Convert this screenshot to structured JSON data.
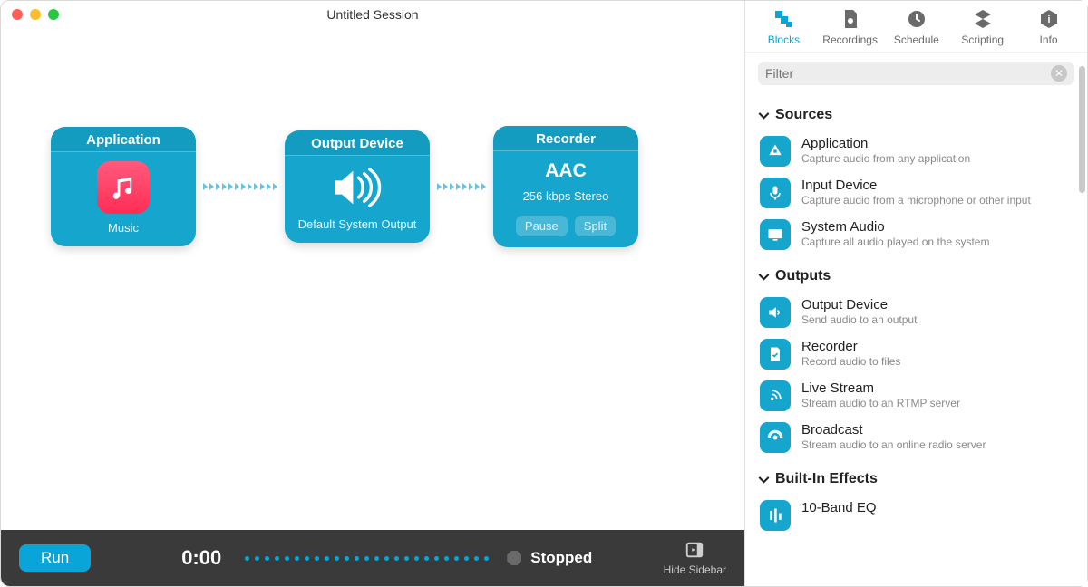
{
  "window": {
    "title": "Untitled Session"
  },
  "flow": {
    "blocks": [
      {
        "header": "Application",
        "label": "Music"
      },
      {
        "header": "Output Device",
        "label": "Default System Output"
      },
      {
        "header": "Recorder",
        "codec": "AAC",
        "detail": "256 kbps Stereo",
        "btn_pause": "Pause",
        "btn_split": "Split"
      }
    ]
  },
  "footer": {
    "run": "Run",
    "time": "0:00",
    "status": "Stopped",
    "hide_sidebar": "Hide Sidebar"
  },
  "tabs": {
    "blocks": "Blocks",
    "recordings": "Recordings",
    "schedule": "Schedule",
    "scripting": "Scripting",
    "info": "Info"
  },
  "filter": {
    "placeholder": "Filter"
  },
  "sections": {
    "sources": {
      "title": "Sources",
      "items": [
        {
          "title": "Application",
          "desc": "Capture audio from any application"
        },
        {
          "title": "Input Device",
          "desc": "Capture audio from a microphone or other input"
        },
        {
          "title": "System Audio",
          "desc": "Capture all audio played on the system"
        }
      ]
    },
    "outputs": {
      "title": "Outputs",
      "items": [
        {
          "title": "Output Device",
          "desc": "Send audio to an output"
        },
        {
          "title": "Recorder",
          "desc": "Record audio to files"
        },
        {
          "title": "Live Stream",
          "desc": "Stream audio to an RTMP server"
        },
        {
          "title": "Broadcast",
          "desc": "Stream audio to an online radio server"
        }
      ]
    },
    "effects": {
      "title": "Built-In Effects",
      "items": [
        {
          "title": "10-Band EQ",
          "desc": ""
        }
      ]
    }
  }
}
